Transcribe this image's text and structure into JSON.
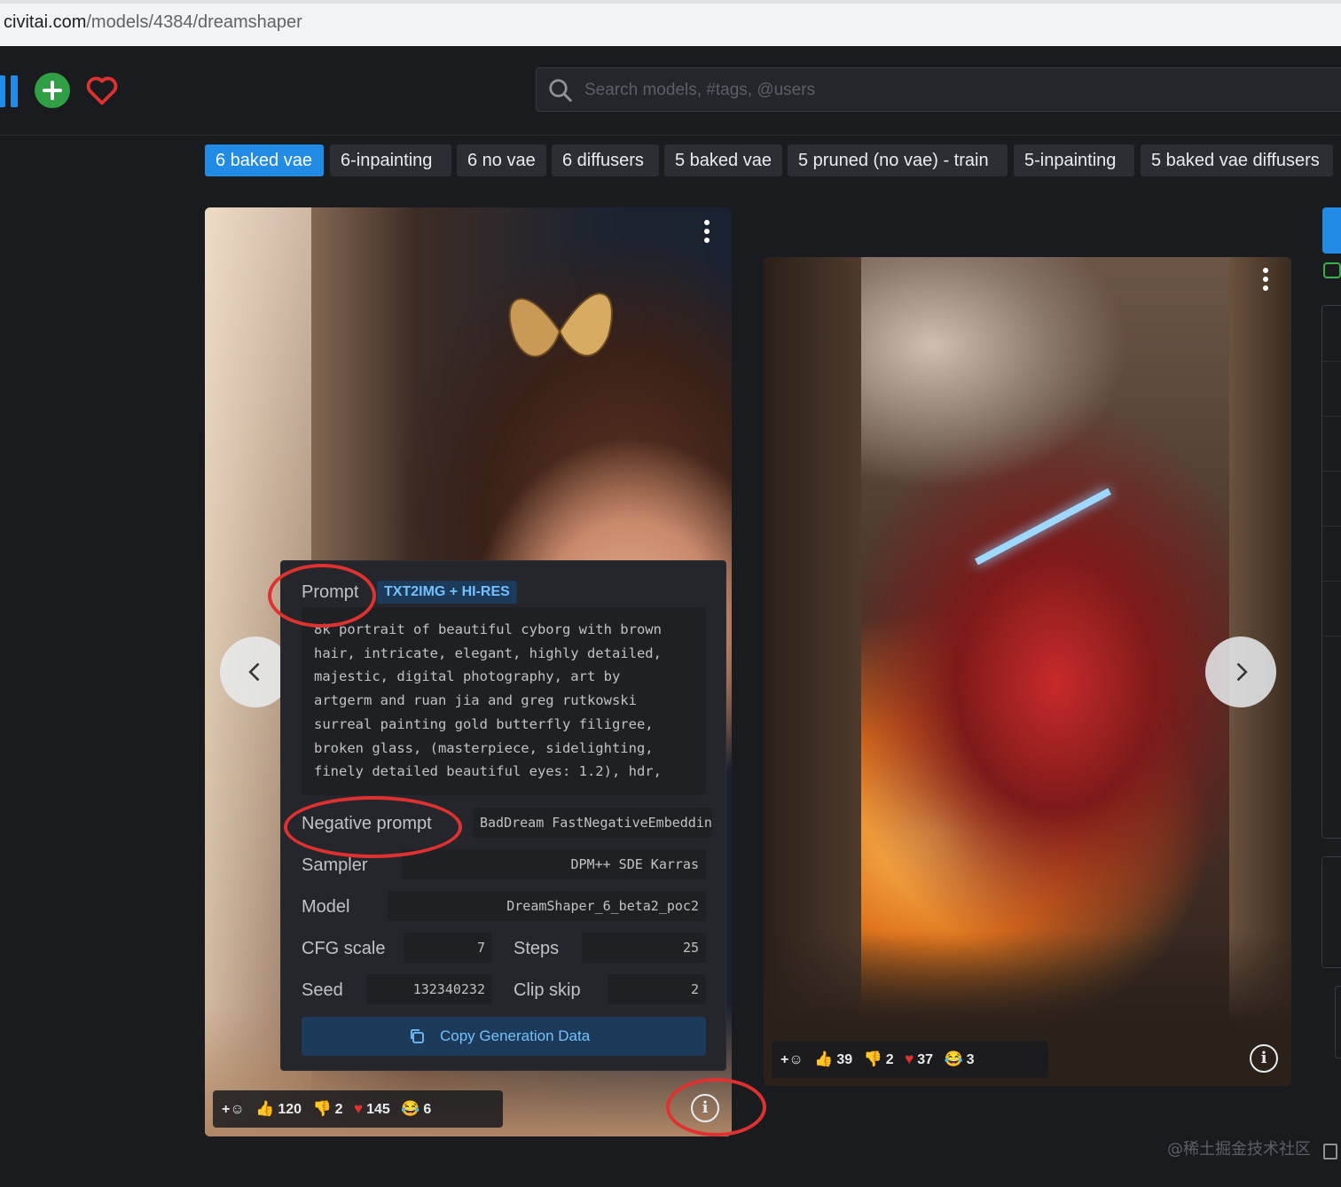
{
  "browser": {
    "url_host": "civitai.com",
    "url_path": "/models/4384/dreamshaper"
  },
  "header": {
    "search_placeholder": "Search models, #tags, @users",
    "icons": [
      "logo-bars-icon",
      "plus-circle-icon",
      "heart-icon",
      "search-icon"
    ],
    "accent_color": "#228be6",
    "create_color": "#2f9e44",
    "heart_color": "#e03131"
  },
  "version_tabs": [
    {
      "label": "6 baked vae",
      "active": true
    },
    {
      "label": "6-inpainting",
      "active": false
    },
    {
      "label": "6 no vae",
      "active": false
    },
    {
      "label": "6 diffusers",
      "active": false
    },
    {
      "label": "5 baked vae",
      "active": false
    },
    {
      "label": "5 pruned (no vae) - train",
      "active": false
    },
    {
      "label": "5-inpainting",
      "active": false
    },
    {
      "label": "5 baked vae diffusers",
      "active": false
    }
  ],
  "generation": {
    "prompt_label": "Prompt",
    "prompt_badge": "TXT2IMG + HI-RES",
    "prompt_text": "8k portrait of beautiful cyborg with brown\nhair, intricate, elegant, highly detailed,\nmajestic, digital photography, art by\nartgerm and ruan jia and greg rutkowski\nsurreal painting gold butterfly filigree,\nbroken glass, (masterpiece, sidelighting,\nfinely detailed beautiful eyes: 1.2), hdr,",
    "negative_label": "Negative prompt",
    "negative_value": "BadDream FastNegativeEmbedding",
    "sampler_label": "Sampler",
    "sampler_value": "DPM++ SDE Karras",
    "model_label": "Model",
    "model_value": "DreamShaper_6_beta2_poc2",
    "cfg_label": "CFG scale",
    "cfg_value": "7",
    "steps_label": "Steps",
    "steps_value": "25",
    "seed_label": "Seed",
    "seed_value": "132340232",
    "clip_label": "Clip skip",
    "clip_value": "2",
    "copy_button": "Copy Generation Data"
  },
  "card1_reactions": {
    "like": "120",
    "dislike": "2",
    "heart": "145",
    "laugh": "6"
  },
  "card2_reactions": {
    "like": "39",
    "dislike": "2",
    "heart": "37",
    "laugh": "3"
  },
  "info_glyph": "i",
  "watermark": "@稀土掘金技术社区"
}
